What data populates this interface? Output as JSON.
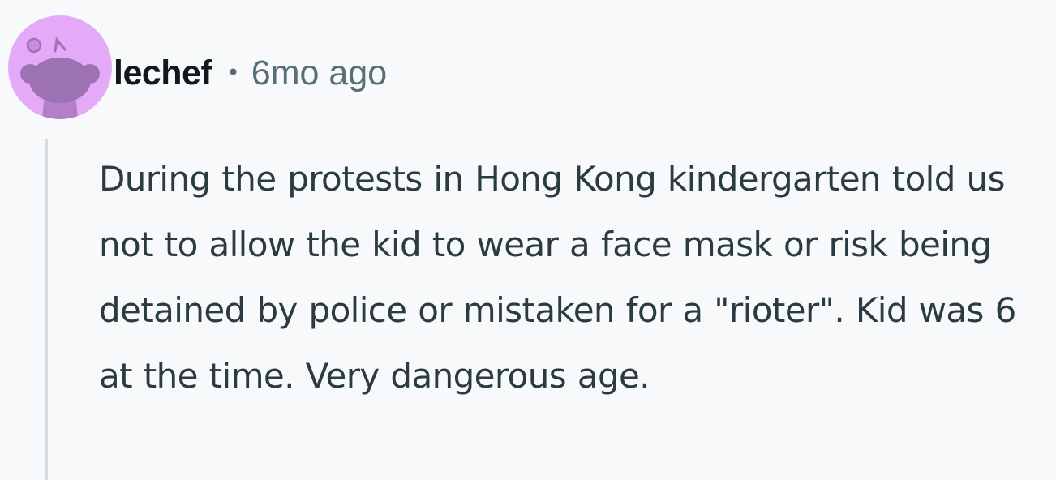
{
  "comment": {
    "author": "lechef",
    "separator": "•",
    "timestamp": "6mo ago",
    "body": "During the protests in Hong Kong kindergarten told us not to allow the kid to wear a face mask or risk being detained by police or mistaken for a \"rioter\". Kid was 6 at the time. Very dangerous age.",
    "avatar": {
      "icon": "reddit-snoo-avatar-icon",
      "background_color": "#e4a9f7",
      "figure_color": "#9d72b3"
    }
  }
}
